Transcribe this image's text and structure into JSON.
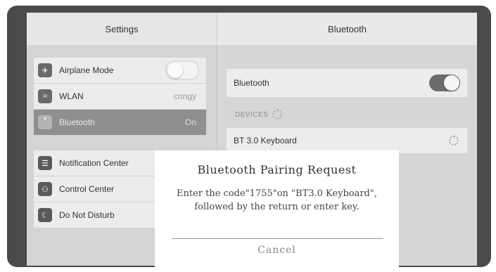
{
  "header": {
    "left_title": "Settings",
    "right_title": "Bluetooth"
  },
  "sidebar": {
    "items": [
      {
        "label": "Airplane Mode",
        "value": "",
        "icon": "airplane-icon"
      },
      {
        "label": "WLAN",
        "value": "cnngy",
        "icon": "wifi-icon"
      },
      {
        "label": "Bluetooth",
        "value": "On",
        "icon": "bluetooth-icon"
      },
      {
        "label": "Notification Center",
        "value": "",
        "icon": "notification-icon"
      },
      {
        "label": "Control Center",
        "value": "",
        "icon": "control-center-icon"
      },
      {
        "label": "Do Not Disturb",
        "value": "",
        "icon": "moon-icon"
      }
    ]
  },
  "bluetooth": {
    "label": "Bluetooth",
    "devices_header": "DEVICES",
    "device_name": "BT 3.0 Keyboard"
  },
  "dialog": {
    "title": "Bluetooth Pairing Request",
    "message": "Enter the code\"1755\"on \"BT3.0 Keyboard\", followed by the return or enter key.",
    "cancel_label": "Cancel"
  },
  "colors": {
    "bezel": "#4a4a4a",
    "selected_row": "#8f8f8f",
    "toggle_on": "#6b6b6b"
  }
}
